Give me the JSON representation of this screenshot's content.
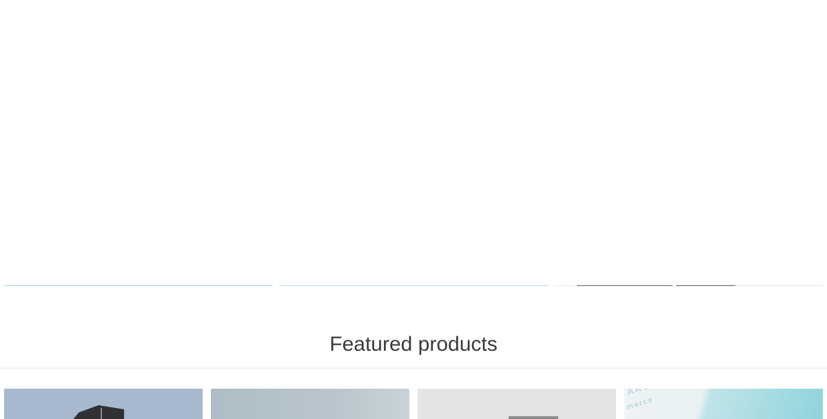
{
  "colors": {
    "heading_text": "#3a3a3a",
    "divider": "#eeeeee",
    "background": "#ffffff"
  },
  "featured": {
    "heading": "Featured products",
    "products": [
      {
        "image": "dark-phone-product-image"
      },
      {
        "image": "grey-blue-product-image"
      },
      {
        "image": "light-grey-product-image"
      },
      {
        "image": "packaging-box-product-image",
        "visible_text": [
          "ARD",
          "merce"
        ]
      }
    ]
  }
}
